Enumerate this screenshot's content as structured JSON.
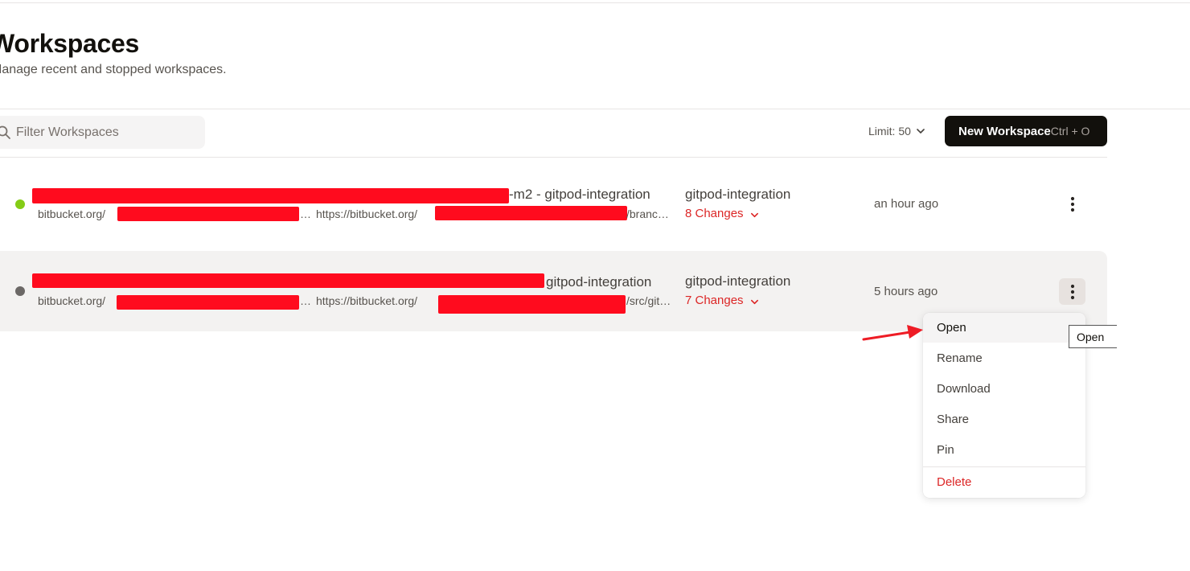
{
  "header": {
    "title": "Workspaces",
    "subtitle": "Manage recent and stopped workspaces."
  },
  "toolbar": {
    "filter_placeholder": "Filter Workspaces",
    "filter_value": "",
    "limit_label": "Limit: 50",
    "new_workspace_label": "New Workspace",
    "new_workspace_shortcut": "Ctrl + O"
  },
  "workspaces": [
    {
      "status": "running",
      "status_color": "#84cc16",
      "title_suffix": "-m2 - gitpod-integration",
      "repo_prefix": "bitbucket.org/",
      "url_prefix": "https://bitbucket.org/",
      "url_suffix": "/branc…",
      "branch": "gitpod-integration",
      "changes": "8 Changes",
      "last_active": "an hour ago"
    },
    {
      "status": "stopped",
      "status_color": "#6b6866",
      "title_suffix": "gitpod-integration",
      "repo_prefix": "bitbucket.org/",
      "url_prefix": "https://bitbucket.org/",
      "url_suffix": "/src/git…",
      "branch": "gitpod-integration",
      "changes": "7 Changes",
      "last_active": "5 hours ago"
    }
  ],
  "context_menu": {
    "items": [
      "Open",
      "Rename",
      "Download",
      "Share",
      "Pin"
    ],
    "danger_item": "Delete",
    "active_item": "Open"
  },
  "tooltip": "Open",
  "colors": {
    "accent_danger": "#dc2626",
    "button_bg": "#12100c",
    "redaction": "#ff0b1e",
    "annotation_arrow": "#ee1c25"
  }
}
